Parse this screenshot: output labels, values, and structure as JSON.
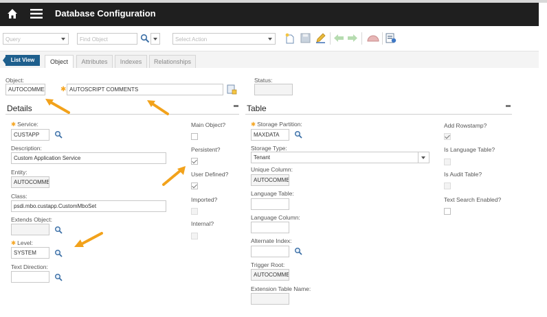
{
  "header": {
    "title": "Database Configuration"
  },
  "toolbar": {
    "query_placeholder": "Query",
    "find_placeholder": "Find Object",
    "action_placeholder": "Select Action"
  },
  "tabs": {
    "list_view": "List View",
    "items": [
      "Object",
      "Attributes",
      "Indexes",
      "Relationships"
    ]
  },
  "object_row": {
    "object_label": "Object:",
    "object_value": "AUTOCOMME",
    "description_value": "AUTOSCRIPT COMMENTS",
    "status_label": "Status:",
    "status_value": ""
  },
  "details": {
    "title": "Details",
    "service_label": "Service:",
    "service_value": "CUSTAPP",
    "description_label": "Description:",
    "description_value": "Custom Application Service",
    "entity_label": "Entity:",
    "entity_value": "AUTOCOMME",
    "class_label": "Class:",
    "class_value": "psdi.mbo.custapp.CustomMboSet",
    "extends_label": "Extends Object:",
    "extends_value": "",
    "level_label": "Level:",
    "level_value": "SYSTEM",
    "text_direction_label": "Text Direction:",
    "text_direction_value": "",
    "main_object_label": "Main Object?",
    "persistent_label": "Persistent?",
    "user_defined_label": "User Defined?",
    "imported_label": "Imported?",
    "internal_label": "Internal?"
  },
  "table": {
    "title": "Table",
    "storage_partition_label": "Storage Partition:",
    "storage_partition_value": "MAXDATA",
    "storage_type_label": "Storage Type:",
    "storage_type_value": "Tenant",
    "unique_column_label": "Unique Column:",
    "unique_column_value": "AUTOCOMME",
    "language_table_label": "Language Table:",
    "language_table_value": "",
    "language_column_label": "Language Column:",
    "language_column_value": "",
    "alternate_index_label": "Alternate Index:",
    "alternate_index_value": "",
    "trigger_root_label": "Trigger Root:",
    "trigger_root_value": "AUTOCOMME",
    "extension_table_label": "Extension Table Name:",
    "extension_table_value": "",
    "add_rowstamp_label": "Add Rowstamp?",
    "is_language_table_label": "Is Language Table?",
    "is_audit_table_label": "Is Audit Table?",
    "text_search_label": "Text Search Enabled?"
  },
  "colors": {
    "required": "#f5a623",
    "arrow": "#f2a21b",
    "header_bg": "#1f1f1f",
    "list_view_bg": "#1e5f8d"
  }
}
